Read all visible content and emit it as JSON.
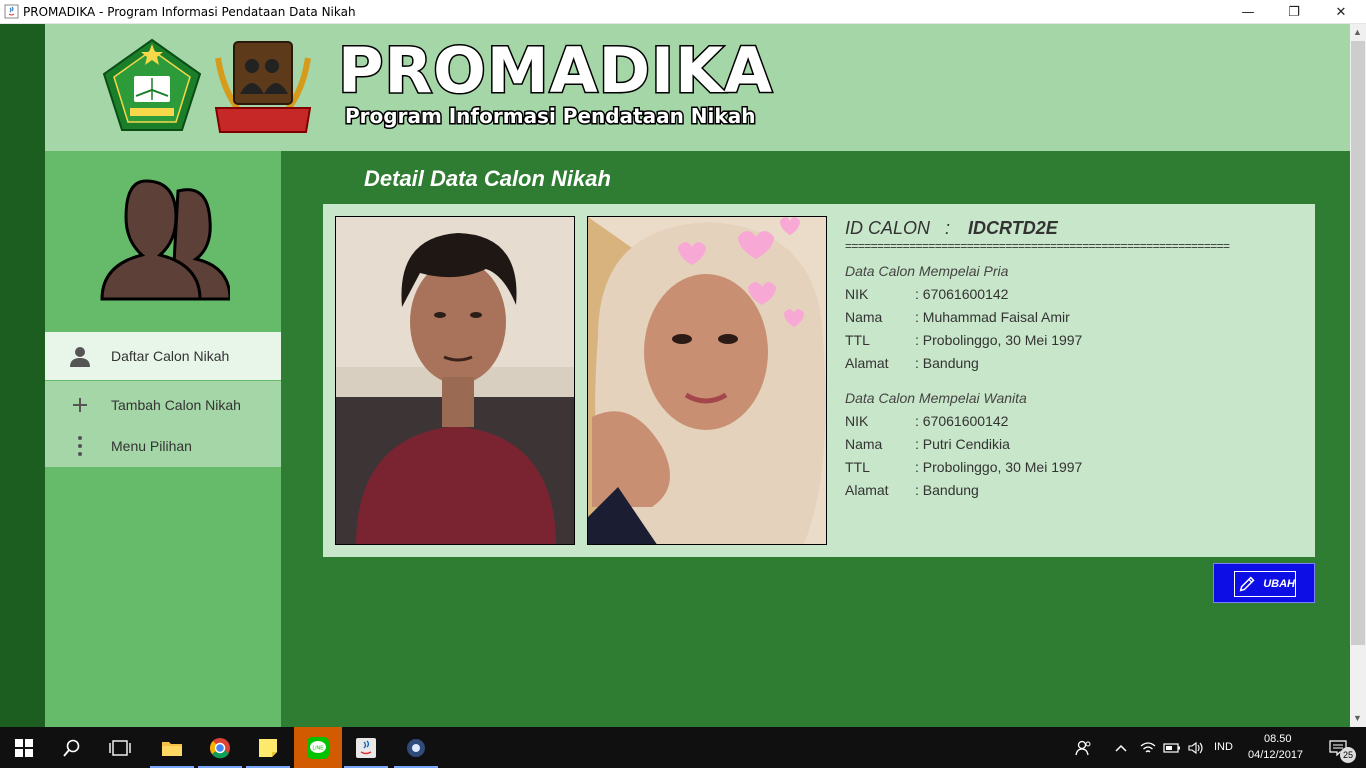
{
  "window": {
    "title": "PROMADIKA - Program Informasi Pendataan Data Nikah",
    "minimize_glyph": "—",
    "restore_glyph": "❐",
    "close_glyph": "✕"
  },
  "header": {
    "brand": "PROMADIKA",
    "subtitle": "Program Informasi Pendataan Nikah"
  },
  "sidebar": {
    "items": [
      {
        "label": "Daftar Calon Nikah",
        "icon": "person-icon"
      },
      {
        "label": "Tambah Calon Nikah",
        "icon": "plus-icon"
      },
      {
        "label": "Menu Pilihan",
        "icon": "more-vertical-icon"
      }
    ]
  },
  "main": {
    "page_title": "Detail Data Calon Nikah",
    "id_label": "ID CALON   :",
    "id_value": "IDCRTD2E",
    "separator": "============================================================",
    "groom": {
      "title": "Data Calon Mempelai Pria",
      "fields": [
        {
          "label": "NIK",
          "value": ": 67061600142"
        },
        {
          "label": "Nama",
          "value": ": Muhammad Faisal Amir"
        },
        {
          "label": "TTL",
          "value": ": Probolinggo, 30 Mei 1997"
        },
        {
          "label": "Alamat",
          "value": ": Bandung"
        }
      ]
    },
    "bride": {
      "title": "Data Calon Mempelai Wanita",
      "fields": [
        {
          "label": "NIK",
          "value": ": 67061600142"
        },
        {
          "label": "Nama",
          "value": ": Putri Cendikia"
        },
        {
          "label": "TTL",
          "value": ": Probolinggo, 30 Mei 1997"
        },
        {
          "label": "Alamat",
          "value": ": Bandung"
        }
      ]
    },
    "edit_button": "UBAH"
  },
  "taskbar": {
    "language": "IND",
    "time": "08.50",
    "date": "04/12/2017",
    "notification_count": "25"
  },
  "colors": {
    "header_bg": "#a5d6a7",
    "main_bg": "#2e7d32",
    "sidebar_bg": "#66bb6a",
    "panel_bg": "#c8e6c9",
    "edit_button_bg": "#0d0de6"
  }
}
